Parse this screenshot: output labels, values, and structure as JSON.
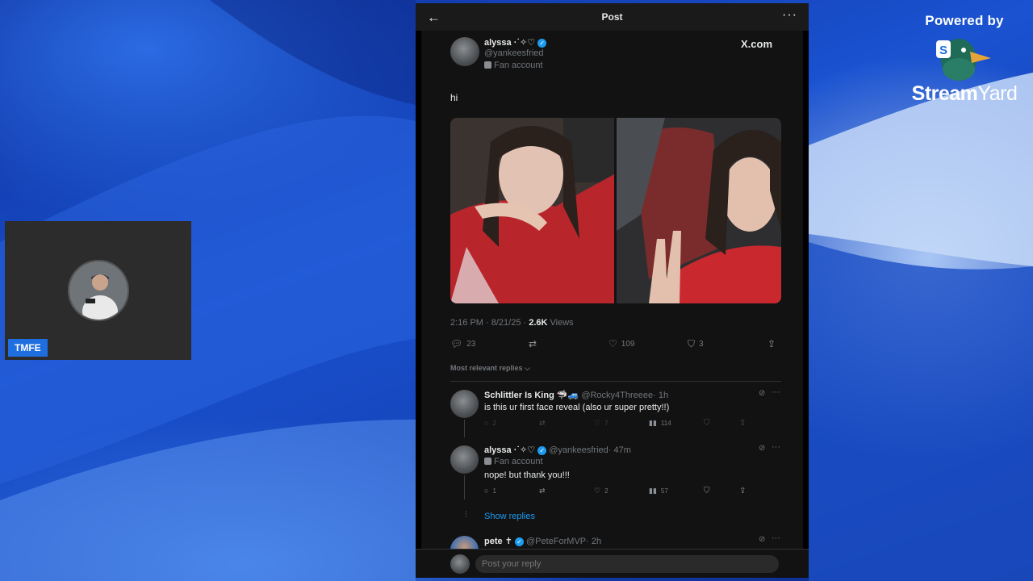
{
  "branding": {
    "powered_by": "Powered by",
    "name_bold": "Stream",
    "name_light": "Yard"
  },
  "guest": {
    "tag": "TMFE"
  },
  "post_view": {
    "header_title": "Post",
    "back_icon": "arrow-left-icon",
    "more_icon": "more-horizontal-icon",
    "source": "X.com",
    "author": {
      "name": "alyssa ·˙✧♡",
      "handle": "@yankeesfried",
      "label": "Fan account"
    },
    "text": "hi",
    "meta": {
      "time": "2:16 PM · 8/21/25 · ",
      "views_count": "2.6K",
      "views_label": " Views"
    },
    "actions": {
      "replies": "23",
      "reposts": "",
      "likes": "109",
      "bookmarks": "3"
    },
    "sort_label": "Most relevant replies ⌵",
    "replies": [
      {
        "name": "Schlittler Is King 🦈🚙",
        "handle": "@Rocky4Threeee",
        "time": "· 1h",
        "text": "is this ur first face reveal (also ur super pretty!!)",
        "replies": "2",
        "reposts": "",
        "likes": "7",
        "views": "114"
      },
      {
        "name": "alyssa ·˙✧♡",
        "handle": "@yankeesfried",
        "time": "· 47m",
        "label": "Fan account",
        "text": "nope! but thank you!!!",
        "replies": "1",
        "reposts": "",
        "likes": "2",
        "views": "57"
      },
      {
        "name": "pete ✝",
        "handle": "@PeteForMVP",
        "time": "· 2h"
      }
    ],
    "show_replies": "Show replies",
    "reply_placeholder": "Post your reply"
  }
}
